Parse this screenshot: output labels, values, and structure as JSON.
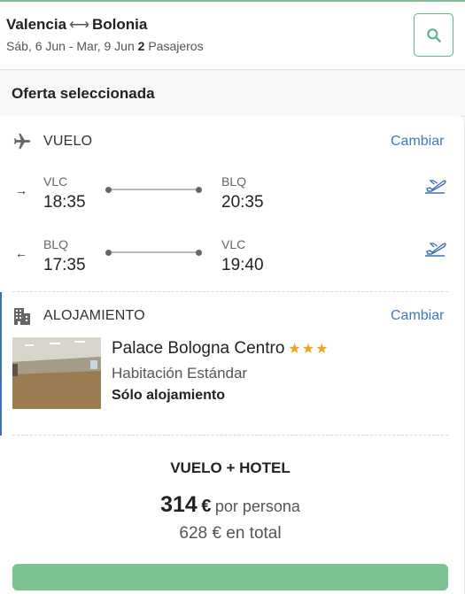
{
  "header": {
    "origin": "Valencia",
    "destination": "Bolonia",
    "dates": "Sáb, 6 Jun - Mar, 9 Jun",
    "passengers_count": "2",
    "passengers_label": "Pasajeros",
    "search_icon": "search-icon"
  },
  "offer_bar": {
    "title": "Oferta seleccionada"
  },
  "flight": {
    "section_label": "VUELO",
    "change_label": "Cambiar",
    "icon": "airplane-icon",
    "outbound": {
      "direction_icon": "arrow-right-icon",
      "from_code": "VLC",
      "from_time": "18:35",
      "to_code": "BLQ",
      "to_time": "20:35",
      "airline_icon": "airplane-takeoff-icon"
    },
    "return": {
      "direction_icon": "arrow-left-icon",
      "from_code": "BLQ",
      "from_time": "17:35",
      "to_code": "VLC",
      "to_time": "19:40",
      "airline_icon": "airplane-takeoff-icon"
    }
  },
  "accommodation": {
    "section_label": "ALOJAMIENTO",
    "change_label": "Cambiar",
    "icon": "building-icon",
    "hotel_name": "Palace Bologna Centro",
    "stars": 3,
    "room_type": "Habitación Estándar",
    "board": "Sólo alojamiento"
  },
  "package": {
    "title": "VUELO + HOTEL",
    "price_per_person": "314",
    "currency": "€",
    "per_person_label": "por persona",
    "total_price": "628",
    "total_label": "en total"
  },
  "colors": {
    "accent_green": "#5fb487",
    "link_blue": "#3b7bbf",
    "star_orange": "#f2a51c",
    "cta_green": "#7cc392"
  }
}
